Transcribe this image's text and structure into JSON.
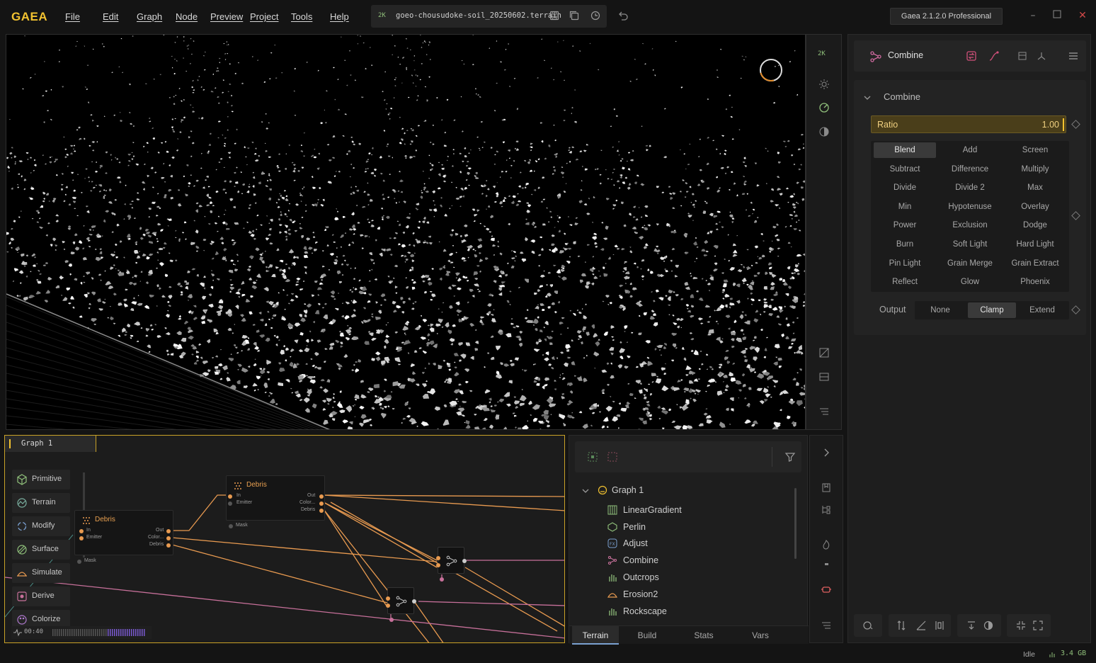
{
  "app": {
    "logo": "GAEA",
    "menu": [
      "File",
      "Edit",
      "Graph",
      "Node",
      "Preview",
      "Project",
      "Tools",
      "Help"
    ],
    "resolution": "2K",
    "file_name": "goeo-chousudoke-soil_20250602.terrain",
    "version": "Gaea 2.1.2.0 Professional"
  },
  "viewport": {
    "resolution": "2K"
  },
  "properties": {
    "node_title": "Combine",
    "section_title": "Combine",
    "ratio": {
      "label": "Ratio",
      "value": "1.00"
    },
    "blend_modes": [
      "Blend",
      "Add",
      "Screen",
      "Subtract",
      "Difference",
      "Multiply",
      "Divide",
      "Divide 2",
      "Max",
      "Min",
      "Hypotenuse",
      "Overlay",
      "Power",
      "Exclusion",
      "Dodge",
      "Burn",
      "Soft Light",
      "Hard Light",
      "Pin Light",
      "Grain Merge",
      "Grain Extract",
      "Reflect",
      "Glow",
      "Phoenix"
    ],
    "selected_blend": "Blend",
    "output": {
      "label": "Output",
      "options": [
        "None",
        "Clamp",
        "Extend"
      ],
      "selected": "Clamp"
    }
  },
  "graph": {
    "tab_label": "Graph 1",
    "categories": [
      "Primitive",
      "Terrain",
      "Modify",
      "Surface",
      "Simulate",
      "Derive",
      "Colorize"
    ],
    "nodes": [
      {
        "title": "Debris",
        "inputs": [
          "In",
          "Emitter"
        ],
        "outputs": [
          "Out",
          "Color...",
          "Debris"
        ],
        "mask": "Mask"
      },
      {
        "title": "Debris",
        "inputs": [
          "In",
          "Emitter"
        ],
        "outputs": [
          "Out",
          "Color...",
          "Debris"
        ],
        "mask": "Mask"
      }
    ],
    "timer": "00:40"
  },
  "tree": {
    "root": "Graph 1",
    "items": [
      "LinearGradient",
      "Perlin",
      "Adjust",
      "Combine",
      "Outcrops",
      "Erosion2",
      "Rockscape"
    ],
    "tabs": [
      "Terrain",
      "Build",
      "Stats",
      "Vars"
    ],
    "selected_tab": "Terrain"
  },
  "status": {
    "state": "Idle",
    "memory": "3.4 GB"
  },
  "colors": {
    "accent": "#f2c230",
    "wire": "#e89a50",
    "wire_pink": "#c7709a",
    "panel": "#1e1e1e"
  }
}
